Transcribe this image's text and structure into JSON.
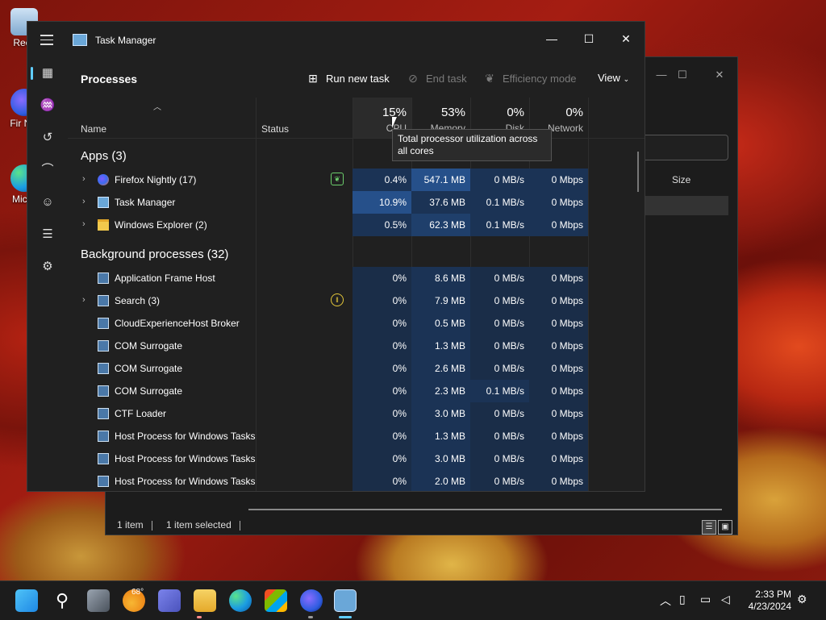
{
  "desktop": {
    "icons": [
      {
        "label": "Recy",
        "icon": "recycle-bin-icon"
      },
      {
        "label": "Fir Nig",
        "icon": "firefox-nightly-icon"
      },
      {
        "label": "Mic E",
        "icon": "edge-icon"
      }
    ]
  },
  "explorer": {
    "column_size": "Size",
    "status_items": "1 item",
    "status_selected": "1 item selected"
  },
  "task_manager": {
    "title": "Task Manager",
    "page_title": "Processes",
    "toolbar": {
      "run_new_task": "Run new task",
      "end_task": "End task",
      "efficiency_mode": "Efficiency mode",
      "view": "View"
    },
    "header": {
      "name": "Name",
      "status": "Status",
      "cpu_pct": "15%",
      "cpu_label": "CPU",
      "memory_pct": "53%",
      "memory_label": "Memory",
      "disk_pct": "0%",
      "disk_label": "Disk",
      "network_pct": "0%",
      "network_label": "Network"
    },
    "tooltip": "Total processor utilization across all cores",
    "groups": {
      "apps": "Apps (3)",
      "background": "Background processes (32)"
    },
    "apps": [
      {
        "name": "Firefox Nightly (17)",
        "cpu": "0.4%",
        "memory": "547.1 MB",
        "disk": "0 MB/s",
        "network": "0 Mbps",
        "status": "efficiency-leaf-icon"
      },
      {
        "name": "Task Manager",
        "cpu": "10.9%",
        "memory": "37.6 MB",
        "disk": "0.1 MB/s",
        "network": "0 Mbps"
      },
      {
        "name": "Windows Explorer (2)",
        "cpu": "0.5%",
        "memory": "62.3 MB",
        "disk": "0.1 MB/s",
        "network": "0 Mbps"
      }
    ],
    "background": [
      {
        "name": "Application Frame Host",
        "cpu": "0%",
        "memory": "8.6 MB",
        "disk": "0 MB/s",
        "network": "0 Mbps"
      },
      {
        "name": "Search (3)",
        "cpu": "0%",
        "memory": "7.9 MB",
        "disk": "0 MB/s",
        "network": "0 Mbps",
        "status": "suspended-pause-icon"
      },
      {
        "name": "CloudExperienceHost Broker",
        "cpu": "0%",
        "memory": "0.5 MB",
        "disk": "0 MB/s",
        "network": "0 Mbps"
      },
      {
        "name": "COM Surrogate",
        "cpu": "0%",
        "memory": "1.3 MB",
        "disk": "0 MB/s",
        "network": "0 Mbps"
      },
      {
        "name": "COM Surrogate",
        "cpu": "0%",
        "memory": "2.6 MB",
        "disk": "0 MB/s",
        "network": "0 Mbps"
      },
      {
        "name": "COM Surrogate",
        "cpu": "0%",
        "memory": "2.3 MB",
        "disk": "0.1 MB/s",
        "network": "0 Mbps"
      },
      {
        "name": "CTF Loader",
        "cpu": "0%",
        "memory": "3.0 MB",
        "disk": "0 MB/s",
        "network": "0 Mbps"
      },
      {
        "name": "Host Process for Windows Tasks",
        "cpu": "0%",
        "memory": "1.3 MB",
        "disk": "0 MB/s",
        "network": "0 Mbps"
      },
      {
        "name": "Host Process for Windows Tasks",
        "cpu": "0%",
        "memory": "3.0 MB",
        "disk": "0 MB/s",
        "network": "0 Mbps"
      },
      {
        "name": "Host Process for Windows Tasks",
        "cpu": "0%",
        "memory": "2.0 MB",
        "disk": "0 MB/s",
        "network": "0 Mbps"
      }
    ]
  },
  "taskbar": {
    "weather_temp": "68°",
    "time": "2:33 PM",
    "date": "4/23/2024"
  },
  "colors": {
    "accent": "#60cdff",
    "heat_low": "#1a2d48",
    "heat_high": "#26508a"
  }
}
